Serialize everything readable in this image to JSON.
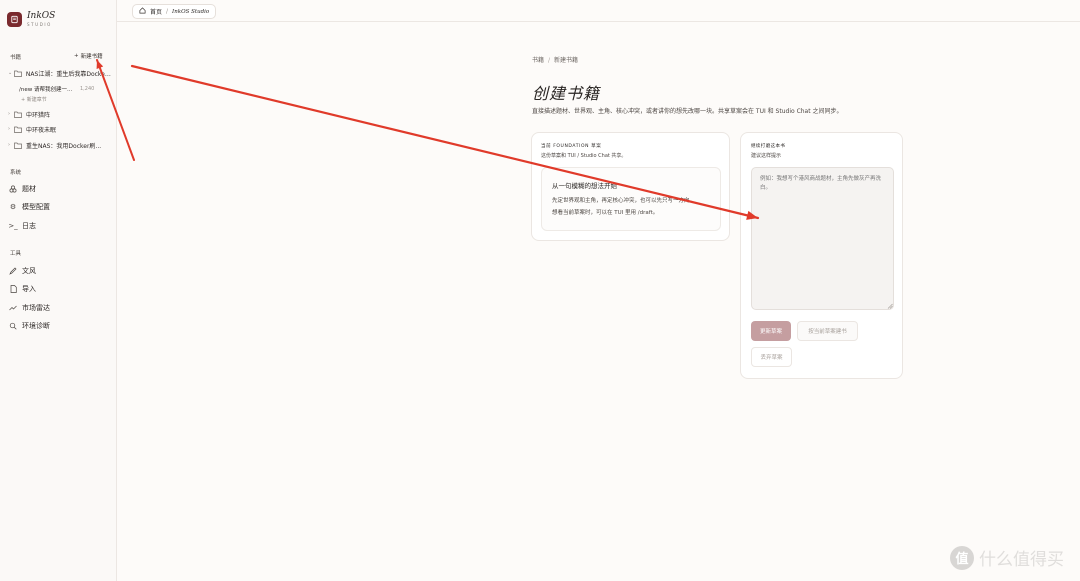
{
  "app": {
    "title": "InkOS",
    "subtitle": "STUDIO"
  },
  "sidebar": {
    "books_label": "书籍",
    "new_book_label": "新建书籍",
    "books": [
      {
        "label": "NAS江湖：重生后我靠Docker..."
      },
      {
        "label": "中环猎阵"
      },
      {
        "label": "中环夜未眠"
      },
      {
        "label": "重生NAS：我用Docker刷..."
      }
    ],
    "chapter": {
      "name": "/new 请帮我创建一...",
      "count": "1,240"
    },
    "new_chapter_label": "新建章节",
    "system_label": "系统",
    "system_items": [
      {
        "label": "题材",
        "icon": "genre-icon"
      },
      {
        "label": "模型配置",
        "icon": "gear-icon"
      },
      {
        "label": "日志",
        "icon": "terminal-icon"
      }
    ],
    "tools_label": "工具",
    "tool_items": [
      {
        "label": "文风",
        "icon": "pen-icon"
      },
      {
        "label": "导入",
        "icon": "file-icon"
      },
      {
        "label": "市场雷达",
        "icon": "trend-icon"
      },
      {
        "label": "环境诊断",
        "icon": "diagnose-icon"
      }
    ]
  },
  "topbar": {
    "home_label": "首页",
    "separator": "/",
    "current": "InkOS Studio"
  },
  "main": {
    "breadcrumb": {
      "parent": "书籍",
      "separator": "/",
      "current": "新建书籍"
    },
    "title": "创建书籍",
    "description": "直接描述题材、世界观、主角、核心冲突，或者讲你的想先改哪一块。共享草案会在 TUI 和 Studio Chat 之间同步。",
    "left_card": {
      "kicker": "当前 FOUNDATION 草案",
      "sub": "这份草案和 TUI / Studio Chat 共享。",
      "inner_title": "从一句模糊的想法开始",
      "inner_line1": "先定世界观和主角，再定核心冲突，也可以先只写一方向。",
      "inner_line2": "想看当前草案时，可以在 TUI 里用 /draft。"
    },
    "right_card": {
      "kicker": "继续打磨这本书",
      "sub": "建议这样提示",
      "placeholder": "例如：我想写个港风商战题材，主角先做灰产再洗白。",
      "primary_button": "更新草案",
      "secondary_button": "按当前草案建书",
      "discard_button": "丢弃草案"
    }
  },
  "annotation": {
    "arrow_color": "#e03a2a"
  },
  "watermark": {
    "badge": "值",
    "text": "什么值得买"
  }
}
